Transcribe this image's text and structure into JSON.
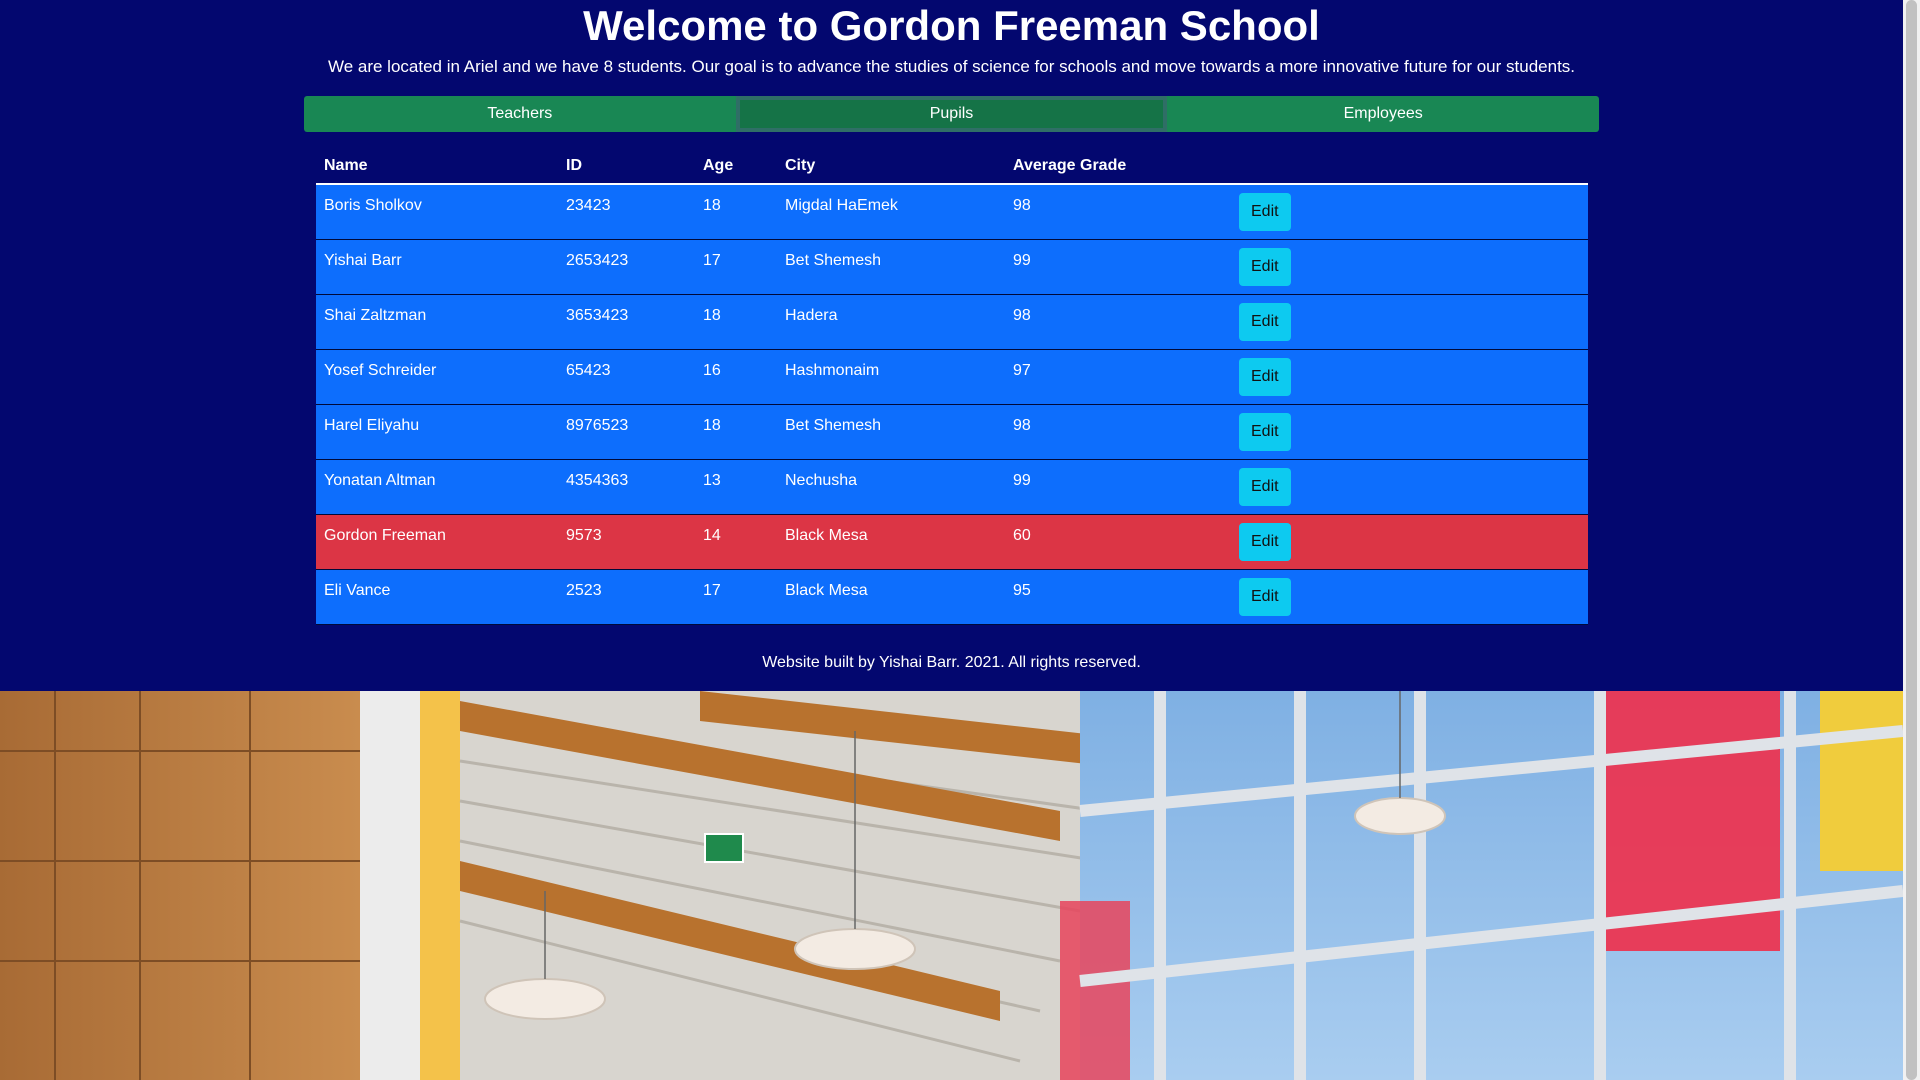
{
  "header": {
    "title": "Welcome to Gordon Freeman School",
    "subtitle": "We are located in Ariel and we have 8 students. Our goal is to advance the studies of science for schools and move towards a more innovative future for our students."
  },
  "tabs": [
    {
      "label": "Teachers",
      "active": false
    },
    {
      "label": "Pupils",
      "active": true
    },
    {
      "label": "Employees",
      "active": false
    }
  ],
  "table": {
    "columns": [
      "Name",
      "ID",
      "Age",
      "City",
      "Average Grade",
      ""
    ],
    "rows": [
      {
        "name": "Boris Sholkov",
        "id": "23423",
        "age": "18",
        "city": "Migdal HaEmek",
        "grade": "98",
        "highlight": false
      },
      {
        "name": "Yishai Barr",
        "id": "2653423",
        "age": "17",
        "city": "Bet Shemesh",
        "grade": "99",
        "highlight": false
      },
      {
        "name": "Shai Zaltzman",
        "id": "3653423",
        "age": "18",
        "city": "Hadera",
        "grade": "98",
        "highlight": false
      },
      {
        "name": "Yosef Schreider",
        "id": "65423",
        "age": "16",
        "city": "Hashmonaim",
        "grade": "97",
        "highlight": false
      },
      {
        "name": "Harel Eliyahu",
        "id": "8976523",
        "age": "18",
        "city": "Bet Shemesh",
        "grade": "98",
        "highlight": false
      },
      {
        "name": "Yonatan Altman",
        "id": "4354363",
        "age": "13",
        "city": "Nechusha",
        "grade": "99",
        "highlight": false
      },
      {
        "name": "Gordon Freeman",
        "id": "9573",
        "age": "14",
        "city": "Black Mesa",
        "grade": "60",
        "highlight": true
      },
      {
        "name": "Eli Vance",
        "id": "2523",
        "age": "17",
        "city": "Black Mesa",
        "grade": "95",
        "highlight": false
      }
    ],
    "edit_label": "Edit"
  },
  "footer": {
    "text": "Website built by Yishai Barr. 2021. All rights reserved."
  },
  "colors": {
    "background": "#03076f",
    "tab_green": "#198754",
    "row_blue": "#0d6efd",
    "row_red": "#dc3545",
    "edit_button": "#0dcaf0"
  }
}
